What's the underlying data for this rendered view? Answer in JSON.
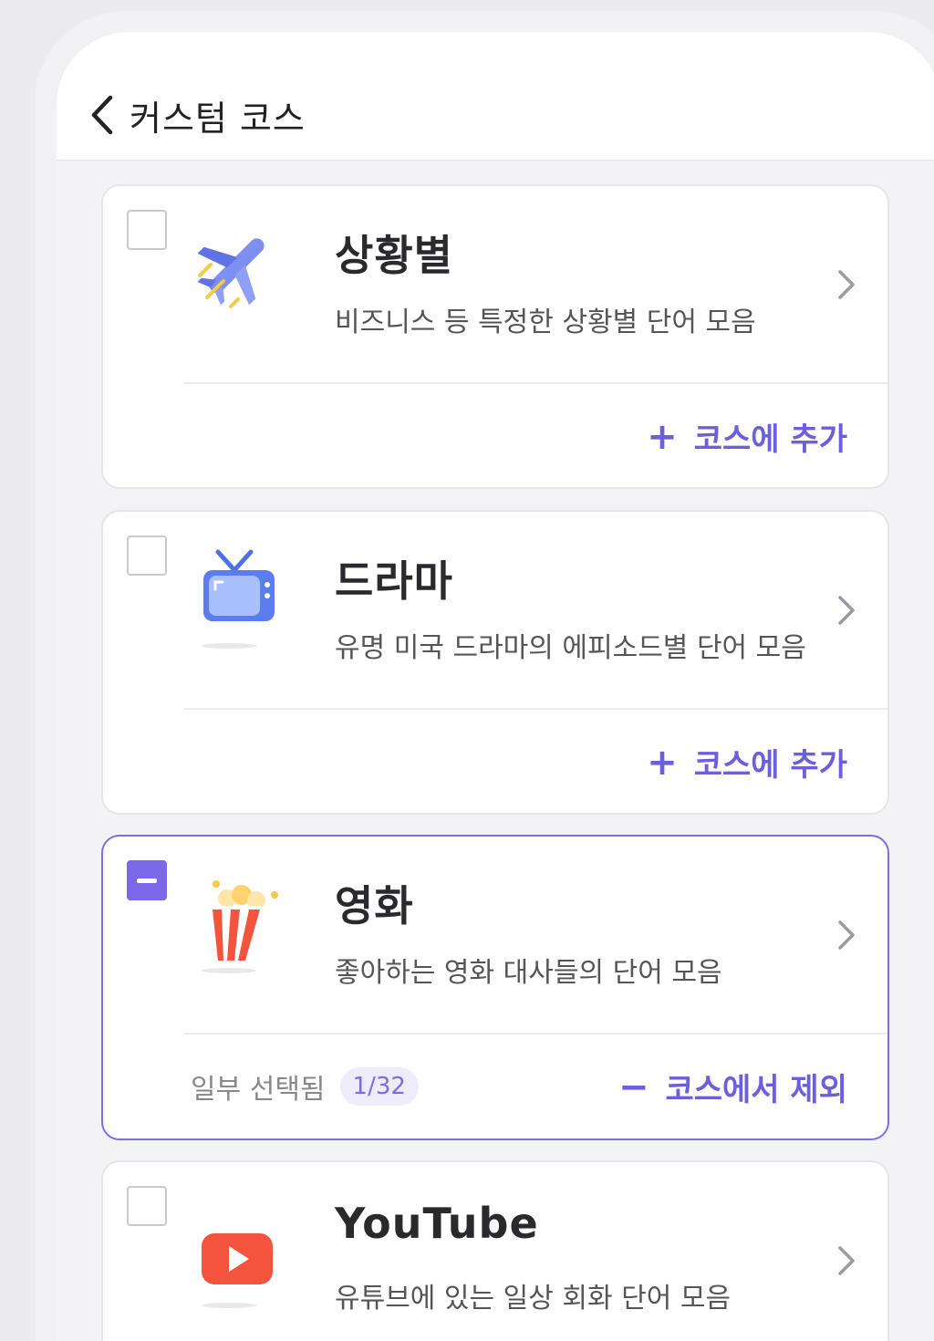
{
  "header": {
    "title": "커스텀 코스"
  },
  "cards": [
    {
      "title": "상황별",
      "description": "비즈니스 등 특정한 상황별 단어 모음",
      "action_sign": "+",
      "action_label": "코스에 추가",
      "icon": "airplane-icon"
    },
    {
      "title": "드라마",
      "description": "유명 미국 드라마의 에피소드별 단어 모음",
      "action_sign": "+",
      "action_label": "코스에 추가",
      "icon": "tv-icon"
    },
    {
      "title": "영화",
      "description": "좋아하는 영화 대사들의 단어 모음",
      "action_sign": "−",
      "action_label": "코스에서 제외",
      "icon": "popcorn-icon",
      "partial_label": "일부 선택됨",
      "partial_count": "1/32"
    },
    {
      "title": "YouTube",
      "description": "유튜브에 있는 일상 회화 단어 모음",
      "icon": "youtube-play-icon"
    }
  ],
  "colors": {
    "accent": "#6c5fdc",
    "checkbox_partial": "#7b68e8"
  }
}
